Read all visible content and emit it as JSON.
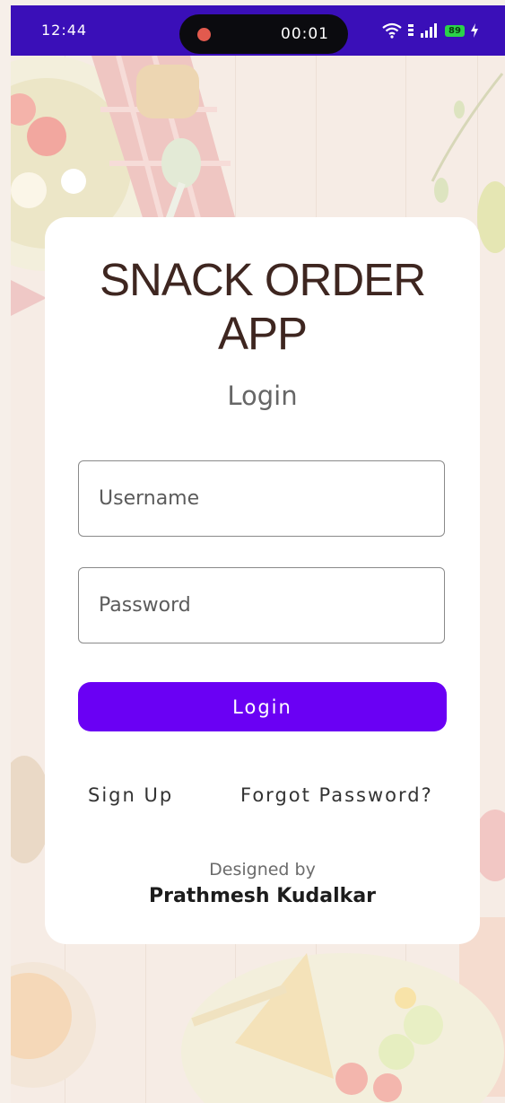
{
  "status_bar": {
    "time": "12:44",
    "record_timer": "00:01",
    "battery_level": "89",
    "bar_color": "#3a0fb8",
    "record_dot_color": "#e25a4e",
    "battery_color": "#2bd24a"
  },
  "icons": {
    "wifi": "wifi-icon",
    "signal": "signal-icon",
    "sim": "sim-icon",
    "charging": "charging-icon",
    "record": "record-dot-icon"
  },
  "login_card": {
    "app_title_line1": "SNACK ORDER",
    "app_title_line2": "APP",
    "subtitle": "Login",
    "username": {
      "placeholder": "Username",
      "value": ""
    },
    "password": {
      "placeholder": "Password",
      "value": ""
    },
    "login_button_label": "Login",
    "sign_up_label": "Sign Up",
    "forgot_password_label": "Forgot Password?",
    "designed_by_label": "Designed by",
    "author_name": "Prathmesh Kudalkar"
  },
  "colors": {
    "accent": "#6a00f4",
    "title": "#3e2620",
    "card_background": "#ffffff"
  }
}
